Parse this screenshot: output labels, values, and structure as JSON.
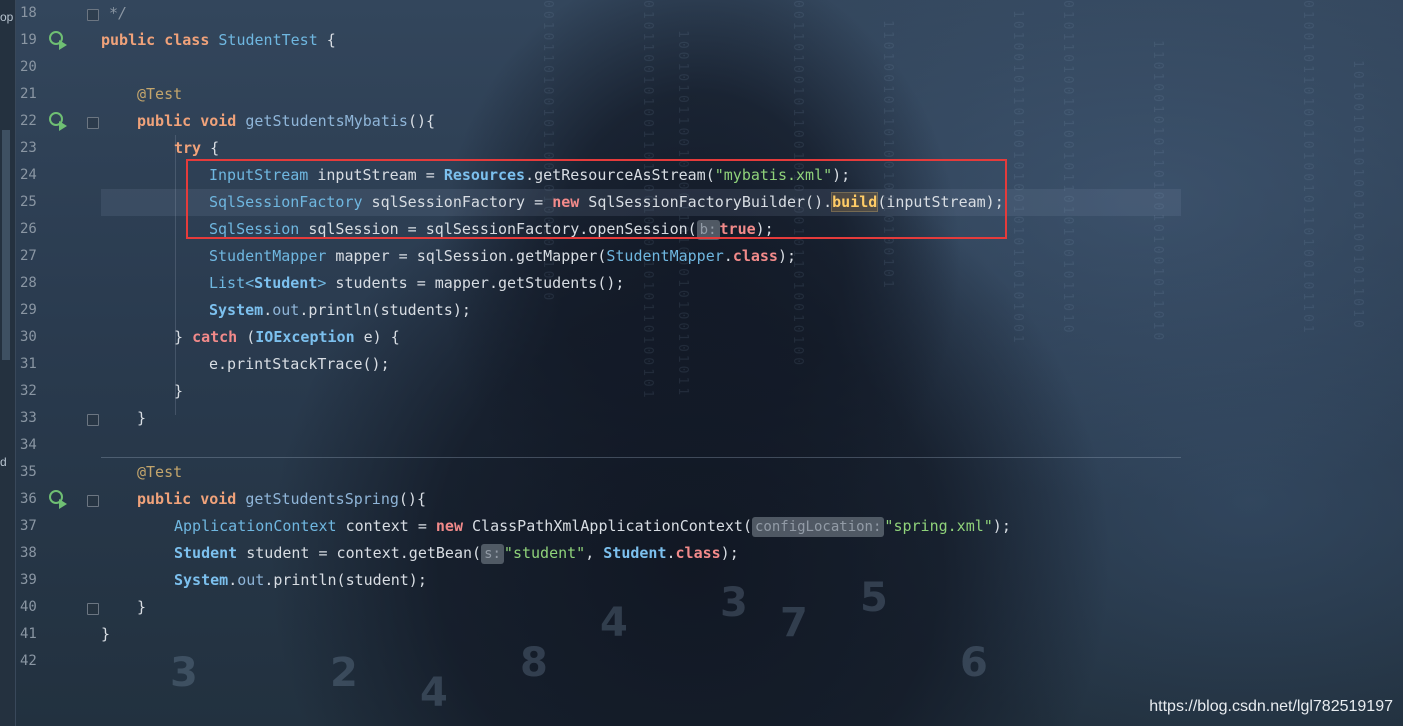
{
  "left_panel": {
    "labels": [
      "op",
      "d"
    ]
  },
  "gutter": {
    "line_numbers": [
      "18",
      "19",
      "20",
      "21",
      "22",
      "23",
      "24",
      "25",
      "26",
      "27",
      "28",
      "29",
      "30",
      "31",
      "32",
      "33",
      "34",
      "35",
      "36",
      "37",
      "38",
      "39",
      "40",
      "41",
      "42"
    ],
    "run_icon": "run-gutter-icon"
  },
  "code": {
    "l18": "*/",
    "l19": {
      "kw1": "public",
      "kw2": "class",
      "name": "StudentTest",
      "rest": " {"
    },
    "l21": {
      "ann": "@Test"
    },
    "l22": {
      "kw1": "public",
      "kw2": "void",
      "method": "getStudentsMybatis",
      "rest": "(){"
    },
    "l23": {
      "kw": "try",
      "rest": " {"
    },
    "l24": {
      "type": "InputStream",
      "p1": " inputStream = ",
      "cls": "Resources",
      "p2": ".getResourceAsStream(",
      "str": "\"mybatis.xml\"",
      "p3": ");"
    },
    "l25": {
      "type": "SqlSessionFactory",
      "p1": " sqlSessionFactory = ",
      "kw": "new",
      "p2": " SqlSessionFactoryBuilder().",
      "hl": "build",
      "p3": "(inputStream);"
    },
    "l26": {
      "type": "SqlSession",
      "p1": " sqlSession = sqlSessionFactory.openSession(",
      "hint": "b:",
      "kw": "true",
      "p2": ");"
    },
    "l27": {
      "type": "StudentMapper",
      "p1": " mapper = sqlSession.getMapper(",
      "type2": "StudentMapper",
      "p2": ".",
      "kw": "class",
      "p3": ");"
    },
    "l28": {
      "type": "List",
      "lt": "<",
      "cls": "Student",
      "gt": ">",
      "p1": " students = mapper.getStudents();"
    },
    "l29": {
      "cls": "System",
      "p1": ".",
      "field": "out",
      "p2": ".println(students);"
    },
    "l30": {
      "p1": "} ",
      "kw": "catch",
      "p2": " (",
      "cls": "IOException",
      "p3": " e) {"
    },
    "l31": "e.printStackTrace();",
    "l32": "}",
    "l33": "}",
    "l35": {
      "ann": "@Test"
    },
    "l36": {
      "kw1": "public",
      "kw2": "void",
      "method": "getStudentsSpring",
      "rest": "(){"
    },
    "l37": {
      "type": "ApplicationContext",
      "p1": " context = ",
      "kw": "new",
      "p2": " ClassPathXmlApplicationContext(",
      "hint": "configLocation:",
      "str": "\"spring.xml\"",
      "p3": ");"
    },
    "l38": {
      "cls": "Student",
      "p1": " student = context.getBean(",
      "hint": "s:",
      "str": "\"student\"",
      "p2": ", ",
      "cls2": "Student",
      "p3": ".",
      "kw": "class",
      "p4": ");"
    },
    "l39": {
      "cls": "System",
      "p1": ".",
      "field": "out",
      "p2": ".println(student);"
    },
    "l40": "}",
    "l41": "}"
  },
  "watermark": "https://blog.csdn.net/lgl782519197",
  "colors": {
    "highlight_box": "#e53b3b",
    "keyword": "#f0a27a",
    "type": "#6fb7e0",
    "string": "#8fd27a",
    "annotation": "#c3a56c"
  }
}
